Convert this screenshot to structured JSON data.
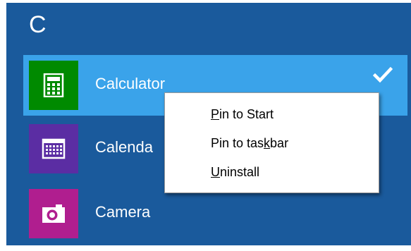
{
  "app_list": {
    "section_letter": "C",
    "items": [
      {
        "label": "Calculator",
        "tile_color": "#008a00",
        "icon": "calculator-icon",
        "selected": true
      },
      {
        "label": "Calenda",
        "tile_color": "#5b2da3",
        "icon": "calendar-icon",
        "selected": false
      },
      {
        "label": "Camera",
        "tile_color": "#b01e8f",
        "icon": "camera-icon",
        "selected": false
      }
    ]
  },
  "selection": {
    "icon": "checkmark-icon",
    "highlight_color": "#3aa3ea"
  },
  "context_menu": {
    "items": [
      {
        "pre": "",
        "key": "P",
        "post": "in to Start"
      },
      {
        "pre": "Pin to tas",
        "key": "k",
        "post": "bar"
      },
      {
        "pre": "",
        "key": "U",
        "post": "ninstall"
      }
    ]
  },
  "colors": {
    "background": "#1a5a9c",
    "menu_background": "#ffffff"
  }
}
